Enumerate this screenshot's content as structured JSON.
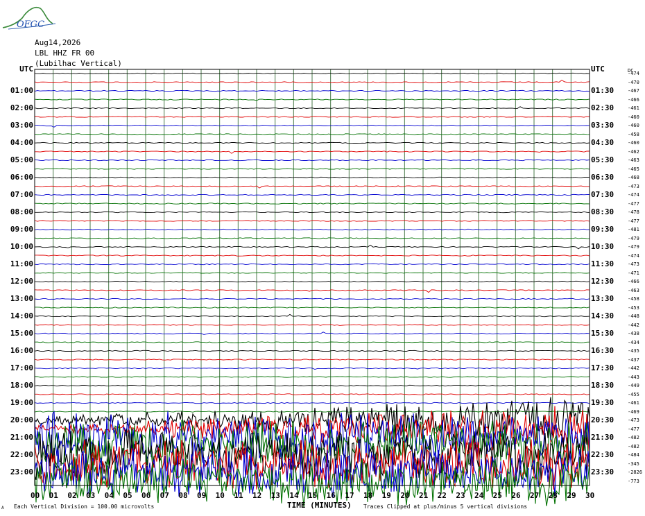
{
  "logo": {
    "text": "OFGC"
  },
  "header": {
    "date": "Aug14,2026",
    "station": "LBL HHZ FR 00",
    "site": "(Lubilhac Vertical)"
  },
  "axis": {
    "left_title": "UTC",
    "right_title": "UTC",
    "dc_title": "DC",
    "x_title": "TIME (MINUTES)"
  },
  "footer": {
    "scale_note": "Each Vertical Division = 100.00 microvolts",
    "clip_note": "Traces Clipped at plus/minus 5 vertical divisions",
    "small_mark": "A"
  },
  "colors": {
    "trace_cycle": [
      "#000000",
      "#e00000",
      "#0000d0",
      "#007000"
    ],
    "grid": "#4a7a4a",
    "frame": "#000000"
  },
  "chart_data": {
    "type": "line",
    "title": "",
    "xlabel": "TIME (MINUTES)",
    "ylabel": "UTC",
    "xlim": [
      0,
      30
    ],
    "x_ticks": [
      "00",
      "01",
      "02",
      "03",
      "04",
      "05",
      "06",
      "07",
      "08",
      "09",
      "10",
      "11",
      "12",
      "13",
      "14",
      "15",
      "16",
      "17",
      "18",
      "19",
      "20",
      "21",
      "22",
      "23",
      "24",
      "25",
      "26",
      "27",
      "28",
      "29",
      "30"
    ],
    "left_ticks": [
      "UTC",
      "01:00",
      "02:00",
      "03:00",
      "04:00",
      "05:00",
      "06:00",
      "07:00",
      "08:00",
      "09:00",
      "10:00",
      "11:00",
      "12:00",
      "13:00",
      "14:00",
      "15:00",
      "16:00",
      "17:00",
      "18:00",
      "19:00",
      "20:00",
      "21:00",
      "22:00",
      "23:00"
    ],
    "right_ticks": [
      "UTC",
      "01:30",
      "02:30",
      "03:30",
      "04:30",
      "05:30",
      "06:30",
      "07:30",
      "08:30",
      "09:30",
      "10:30",
      "11:30",
      "12:30",
      "13:30",
      "14:30",
      "15:30",
      "16:30",
      "17:30",
      "18:30",
      "19:30",
      "20:30",
      "21:30",
      "22:30",
      "23:30"
    ],
    "dc_offsets": [
      "-474",
      "-470",
      "-467",
      "-466",
      "-461",
      "-460",
      "-460",
      "-458",
      "-460",
      "-462",
      "-463",
      "-465",
      "-468",
      "-473",
      "-474",
      "-477",
      "-478",
      "-477",
      "-481",
      "-479",
      "-479",
      "-474",
      "-473",
      "-471",
      "-466",
      "-463",
      "-458",
      "-453",
      "-448",
      "-442",
      "-438",
      "-434",
      "-435",
      "-437",
      "-442",
      "-443",
      "-449",
      "-455",
      "-461",
      "-469",
      "-473",
      "-477",
      "-482",
      "-482",
      "-484",
      "-345",
      "-2826",
      "-773"
    ],
    "trace_count": 48,
    "trace_minutes": 30,
    "grid": true,
    "clipping_divisions": 5,
    "units_per_division": "100.00 microvolts",
    "active_segment": {
      "start_trace": 40,
      "end_trace": 47,
      "note": "high amplitude clipped activity from about 20:00 UTC to end of day"
    }
  }
}
